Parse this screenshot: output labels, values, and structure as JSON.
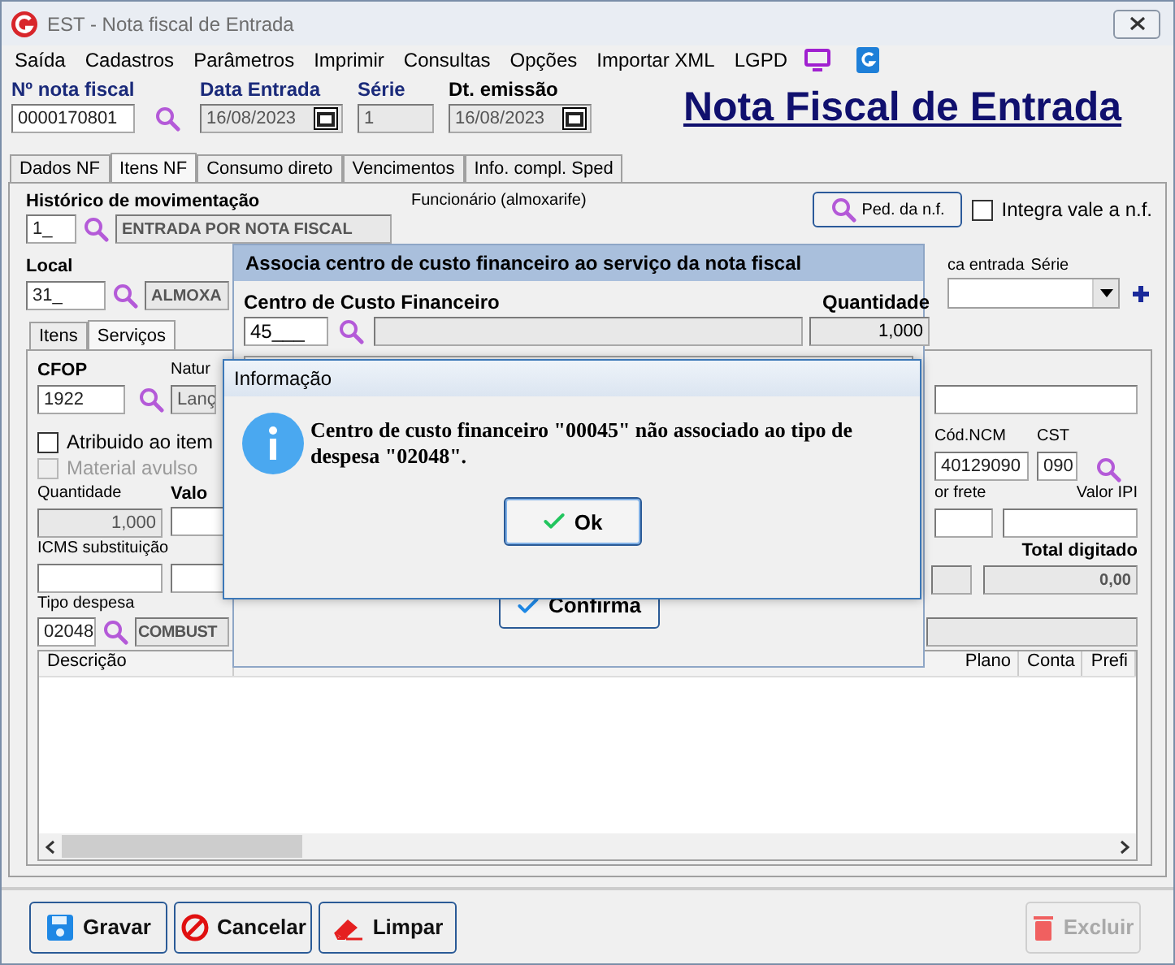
{
  "window": {
    "title": "EST - Nota fiscal de Entrada"
  },
  "menu": [
    "Saída",
    "Cadastros",
    "Parâmetros",
    "Imprimir",
    "Consultas",
    "Opções",
    "Importar XML",
    "LGPD"
  ],
  "header": {
    "title": "Nota Fiscal de Entrada",
    "fields": [
      {
        "label": "Nº nota fiscal",
        "value": "0000170801",
        "kind": "lookup",
        "emphasis": true
      },
      {
        "label": "Data Entrada",
        "value": "16/08/2023",
        "kind": "date",
        "emphasis": true
      },
      {
        "label": "Série",
        "value": "1",
        "kind": "text",
        "emphasis": true
      },
      {
        "label": "Dt. emissão",
        "value": "16/08/2023",
        "kind": "date",
        "emphasis": false
      }
    ]
  },
  "tabs": [
    {
      "label": "Dados NF",
      "selected": false
    },
    {
      "label": "Itens NF",
      "selected": true
    },
    {
      "label": "Consumo direto",
      "selected": false
    },
    {
      "label": "Vencimentos",
      "selected": false
    },
    {
      "label": "Info. compl. Sped",
      "selected": false
    }
  ],
  "form": {
    "historico": {
      "label": "Histórico de movimentação",
      "code": "1_",
      "description": "ENTRADA POR NOTA FISCAL"
    },
    "funcionario": {
      "label": "Funcionário (almoxarife)"
    },
    "ped_button": "Ped. da n.f.",
    "integra": {
      "label": "Integra vale a n.f.",
      "checked": false
    },
    "local": {
      "label": "Local",
      "code": "31_",
      "description": "ALMOXA"
    },
    "right_labels": [
      "ca entrada",
      "Série"
    ],
    "subtabs": [
      {
        "label": "Itens",
        "selected": false
      },
      {
        "label": "Serviços",
        "selected": true
      }
    ],
    "cfop": {
      "label": "CFOP",
      "value": "1922"
    },
    "natureza": {
      "label": "Natur",
      "value": "Lanç"
    },
    "checks": [
      {
        "label": "Atribuido ao item",
        "checked": false,
        "disabled": false
      },
      {
        "label": "Material avulso",
        "checked": false,
        "disabled": true
      }
    ],
    "quantidade": {
      "label": "Quantidade",
      "value": "1,000"
    },
    "valor_label": "Valo",
    "icms_label": "ICMS substituição",
    "tipo_despesa": {
      "label": "Tipo despesa",
      "code": "02048",
      "description": "COMBUST"
    },
    "ncm": {
      "label": "Cód.NCM",
      "value": "40129090"
    },
    "cst": {
      "label": "CST",
      "value": "090"
    },
    "frete_label": "or frete",
    "ipi_label": "Valor IPI",
    "total": {
      "label": "Total digitado",
      "value": "0,00"
    },
    "table_columns": [
      "Descrição",
      "Plano",
      "Conta",
      "Prefi"
    ]
  },
  "dialog": {
    "title": "Associa centro de custo financeiro ao serviço da nota fiscal",
    "centro_label": "Centro de Custo Financeiro",
    "centro_value": "45___",
    "quantidade_label": "Quantidade",
    "quantidade_value": "1,000",
    "confirm": "Confirma"
  },
  "info": {
    "title": "Informação",
    "message": "Centro de custo financeiro \"00045\" não associado ao tipo de despesa \"02048\".",
    "ok": "Ok"
  },
  "footer": [
    {
      "label": "Gravar",
      "kind": "save",
      "disabled": false
    },
    {
      "label": "Cancelar",
      "kind": "cancel",
      "disabled": false
    },
    {
      "label": "Limpar",
      "kind": "clear",
      "disabled": false
    },
    {
      "label": "Excluir",
      "kind": "delete",
      "disabled": true
    }
  ]
}
